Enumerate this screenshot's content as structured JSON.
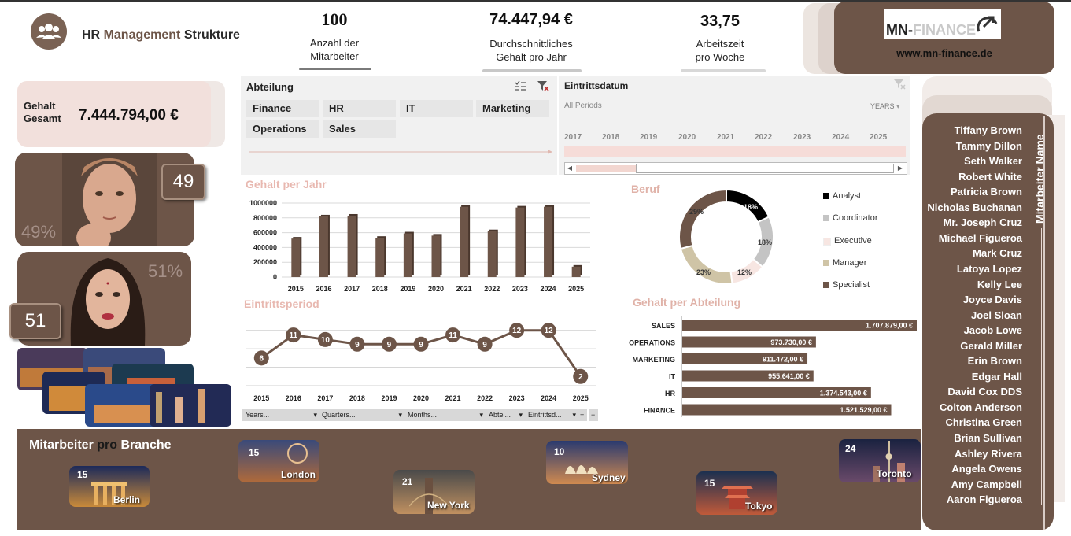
{
  "header": {
    "title_part1": "HR",
    "title_part2": "Management",
    "title_part3": "Strukture",
    "kpis": [
      {
        "value": "100",
        "label_line1": "Anzahl der",
        "label_line2": "Mitarbeiter"
      },
      {
        "value": "74.447,94 €",
        "label_line1": "Durchschnittliches",
        "label_line2": "Gehalt pro Jahr"
      },
      {
        "value": "33,75",
        "label_line1": "Arbeitszeit",
        "label_line2": "pro Woche"
      }
    ]
  },
  "brand": {
    "logo_text_dark": "MN-",
    "logo_text_light": "FINANCE",
    "url": "www.mn-finance.de"
  },
  "gesamt": {
    "label_line1": "Gehalt",
    "label_line2": "Gesamt",
    "value": "7.444.794,00 €"
  },
  "gender": {
    "male_pct": "49%",
    "male_count": "49",
    "female_pct": "51%",
    "female_count": "51"
  },
  "slicer_abteilung": {
    "title": "Abteilung",
    "items": [
      "Finance",
      "HR",
      "IT",
      "Marketing",
      "Operations",
      "Sales"
    ]
  },
  "slicer_eintritt": {
    "title": "Eintrittsdatum",
    "periods_label": "All Periods",
    "level_label": "YEARS",
    "years": [
      "2017",
      "2018",
      "2019",
      "2020",
      "2021",
      "2022",
      "2023",
      "2024",
      "2025"
    ]
  },
  "chart_gehalt_jahr": {
    "title": "Gehalt per Jahr"
  },
  "chart_eintritt": {
    "title": "Eintrittsperiod",
    "field_buttons": [
      "Years...",
      "Quarters...",
      "Months...",
      "Abtei...",
      "Eintrittsd..."
    ]
  },
  "chart_beruf": {
    "title": "Beruf"
  },
  "chart_abteilung": {
    "title": "Gehalt per Abteilung"
  },
  "chart_data": [
    {
      "type": "bar",
      "title": "Gehalt per Jahr",
      "categories": [
        "2015",
        "2016",
        "2017",
        "2018",
        "2019",
        "2020",
        "2021",
        "2022",
        "2023",
        "2024",
        "2025"
      ],
      "values": [
        520000,
        820000,
        830000,
        530000,
        590000,
        560000,
        950000,
        620000,
        940000,
        950000,
        140000
      ],
      "y_ticks": [
        "0",
        "200000",
        "400000",
        "600000",
        "800000",
        "1000000"
      ],
      "ylim": [
        0,
        1000000
      ],
      "grid": true,
      "color": "#6d5548"
    },
    {
      "type": "line",
      "title": "Eintrittsperiod",
      "categories": [
        "2015",
        "2016",
        "2017",
        "2018",
        "2019",
        "2020",
        "2021",
        "2022",
        "2023",
        "2024",
        "2025"
      ],
      "values": [
        6,
        11,
        10,
        9,
        9,
        9,
        11,
        9,
        12,
        12,
        2
      ],
      "ylim": [
        0,
        14
      ],
      "grid": true,
      "color": "#6d5548"
    },
    {
      "type": "pie",
      "title": "Beruf",
      "labels": [
        "Analyst",
        "Coordinator",
        "Executive",
        "Manager",
        "Specialist"
      ],
      "values": [
        18,
        18,
        12,
        23,
        29
      ],
      "value_labels": [
        "18%",
        "18%",
        "12%",
        "23%",
        "29%"
      ],
      "colors": [
        "#000000",
        "#c4c4c4",
        "#f7e6e2",
        "#cfc4a6",
        "#6d5548"
      ],
      "legend": "right"
    },
    {
      "type": "bar",
      "title": "Gehalt per Abteilung",
      "orientation": "horizontal",
      "categories": [
        "SALES",
        "OPERATIONS",
        "MARKETING",
        "IT",
        "HR",
        "FINANCE"
      ],
      "values": [
        1707879,
        973730,
        911472,
        955641,
        1374543,
        1521529
      ],
      "value_labels": [
        "1.707.879,00 €",
        "973.730,00 €",
        "911.472,00 €",
        "955.641,00 €",
        "1.374.543,00 €",
        "1.521.529,00 €"
      ],
      "color": "#6d5548"
    }
  ],
  "branche": {
    "title_part1": "Mitarbeiter",
    "title_part2": "pro",
    "title_part3": "Branche",
    "cities": [
      {
        "name": "Berlin",
        "count": "15"
      },
      {
        "name": "London",
        "count": "15"
      },
      {
        "name": "New York",
        "count": "21"
      },
      {
        "name": "Sydney",
        "count": "10"
      },
      {
        "name": "Tokyo",
        "count": "15"
      },
      {
        "name": "Toronto",
        "count": "24"
      }
    ]
  },
  "employees": {
    "title": "Mitarbeiter Name",
    "names": [
      "Tiffany Brown",
      "Tammy Dillon",
      "Seth Walker",
      "Robert White",
      "Patricia Brown",
      "Nicholas Buchanan",
      "Mr. Joseph Cruz",
      "Michael Figueroa",
      "Mark Cruz",
      "Latoya Lopez",
      "Kelly Lee",
      "Joyce Davis",
      "Joel Sloan",
      "Jacob Lowe",
      "Gerald Miller",
      "Erin Brown",
      "Edgar Hall",
      "David Cox DDS",
      "Colton Anderson",
      "Christina Green",
      "Brian Sullivan",
      "Ashley Rivera",
      "Angela Owens",
      "Amy Campbell",
      "Aaron Figueroa"
    ]
  },
  "icons": {
    "users": "users-group-icon",
    "multiselect": "multi-select-icon",
    "clear_filter": "clear-filter-icon"
  }
}
